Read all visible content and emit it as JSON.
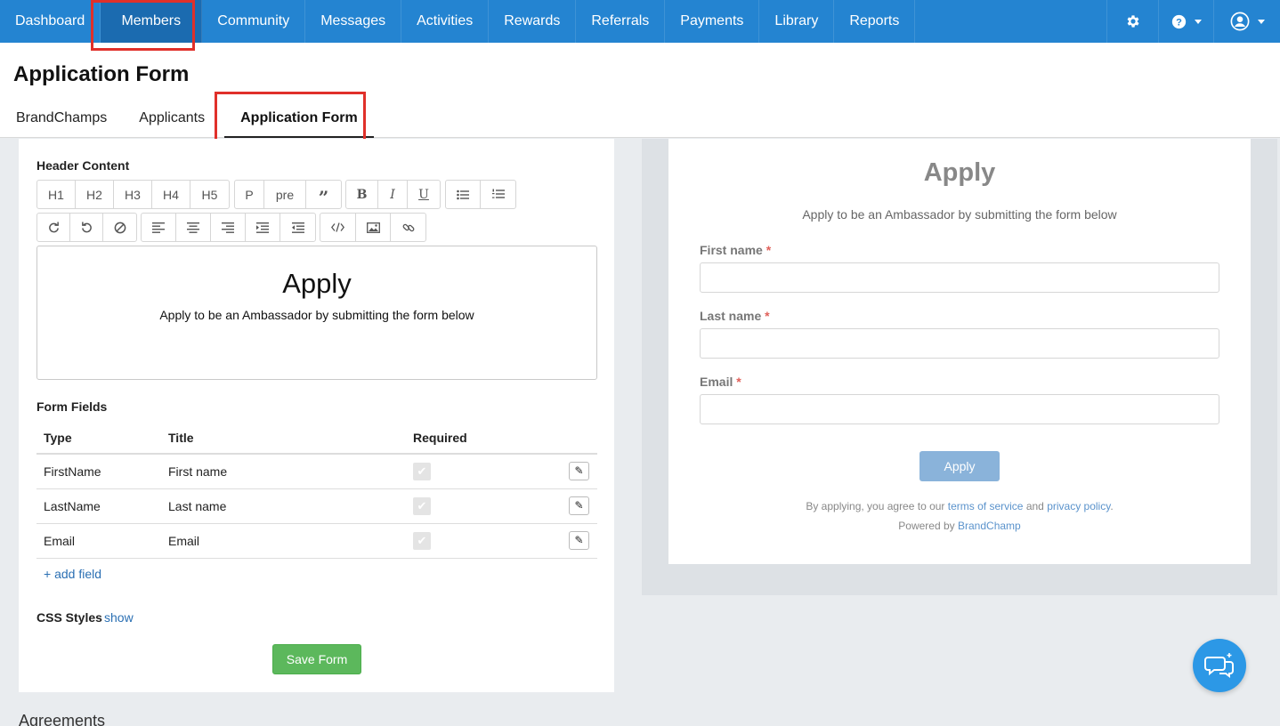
{
  "topnav": {
    "items": [
      {
        "label": "Dashboard"
      },
      {
        "label": "Members"
      },
      {
        "label": "Community"
      },
      {
        "label": "Messages"
      },
      {
        "label": "Activities"
      },
      {
        "label": "Rewards"
      },
      {
        "label": "Referrals"
      },
      {
        "label": "Payments"
      },
      {
        "label": "Library"
      },
      {
        "label": "Reports"
      }
    ],
    "active": "Members",
    "icons": [
      "gear-icon",
      "help-icon",
      "user-icon"
    ],
    "accent": "#2484d1"
  },
  "page": {
    "title": "Application Form",
    "tabs": [
      {
        "label": "BrandChamps"
      },
      {
        "label": "Applicants"
      },
      {
        "label": "Application Form"
      }
    ],
    "active_tab": "Application Form"
  },
  "editor": {
    "header_label": "Header Content",
    "toolbar_row1": [
      "H1",
      "H2",
      "H3",
      "H4",
      "H5",
      "P",
      "pre"
    ],
    "toolbar_icons": [
      "quote-icon",
      "bold-icon",
      "italic-icon",
      "underline-icon",
      "bullet-list-icon",
      "numbered-list-icon",
      "redo-icon",
      "undo-icon",
      "clear-format-icon",
      "align-left-icon",
      "align-center-icon",
      "align-right-icon",
      "indent-icon",
      "outdent-icon",
      "code-icon",
      "image-icon",
      "link-icon"
    ],
    "bold": "B",
    "italic": "I",
    "underline": "U",
    "content_heading": "Apply",
    "content_text": "Apply to be an Ambassador by submitting the form below"
  },
  "form_fields": {
    "label": "Form Fields",
    "columns": [
      "Type",
      "Title",
      "Required"
    ],
    "rows": [
      {
        "type": "FirstName",
        "title": "First name",
        "required": true
      },
      {
        "type": "LastName",
        "title": "Last name",
        "required": true
      },
      {
        "type": "Email",
        "title": "Email",
        "required": true
      }
    ],
    "add_field": "+ add field"
  },
  "css_styles": {
    "label": "CSS Styles",
    "toggle": "show"
  },
  "save_button": "Save Form",
  "agreements_label": "Agreements",
  "preview": {
    "title": "Apply",
    "subtitle": "Apply to be an Ambassador by submitting the form below",
    "fields": [
      {
        "label": "First name",
        "required_mark": "*"
      },
      {
        "label": "Last name",
        "required_mark": "*"
      },
      {
        "label": "Email",
        "required_mark": "*"
      }
    ],
    "apply_button": "Apply",
    "terms_prefix": "By applying, you agree to our",
    "terms_link": "terms of service",
    "terms_and": "and",
    "privacy_link": "privacy policy",
    "terms_suffix": ".",
    "powered_prefix": "Powered by",
    "powered_link": "BrandChamp"
  }
}
